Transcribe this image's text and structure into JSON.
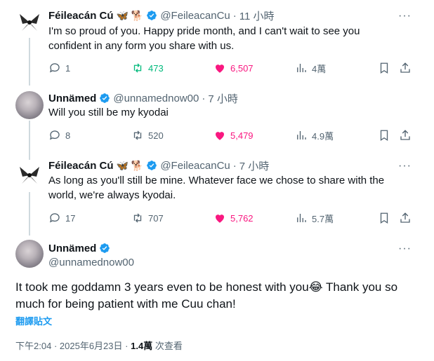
{
  "replies": [
    {
      "name": "Féileacán Cú",
      "emojis": "🦋 🐕",
      "handle": "@FeileacanCu",
      "time": "11 小時",
      "text": "I'm so proud of you. Happy pride month, and I can't wait to see you confident in any form you share with us.",
      "stats": {
        "reply": "1",
        "retweet": "473",
        "like": "6,507",
        "views": "4萬"
      },
      "retweeted": true,
      "liked": true
    },
    {
      "name": "Unnämed",
      "handle": "@unnamednow00",
      "time": "7 小時",
      "text": "Will you still be my kyodai",
      "stats": {
        "reply": "8",
        "retweet": "520",
        "like": "5,479",
        "views": "4.9萬"
      },
      "retweeted": false,
      "liked": true
    },
    {
      "name": "Féileacán Cú",
      "emojis": "🦋 🐕",
      "handle": "@FeileacanCu",
      "time": "7 小時",
      "text": "As long as you'll still be mine. Whatever face we chose to share with the world, we're always kyodai.",
      "stats": {
        "reply": "17",
        "retweet": "707",
        "like": "5,762",
        "views": "5.7萬"
      },
      "retweeted": false,
      "liked": true
    }
  ],
  "main_tweet": {
    "name": "Unnämed",
    "handle": "@unnamednow00",
    "text": "It took me goddamn 3 years even to be honest with you😂 Thank you so much for being patient with me Cuu chan!",
    "translate_label": "翻譯貼文",
    "time": "下午2:04",
    "date": "2025年6月23日",
    "views": "1.4萬",
    "views_label": "次查看"
  },
  "ui": {
    "separator": "·",
    "more": "···"
  },
  "colors": {
    "verified": "#1d9bf0",
    "like": "#f91880",
    "retweet": "#00ba7c",
    "secondary": "#536471"
  }
}
